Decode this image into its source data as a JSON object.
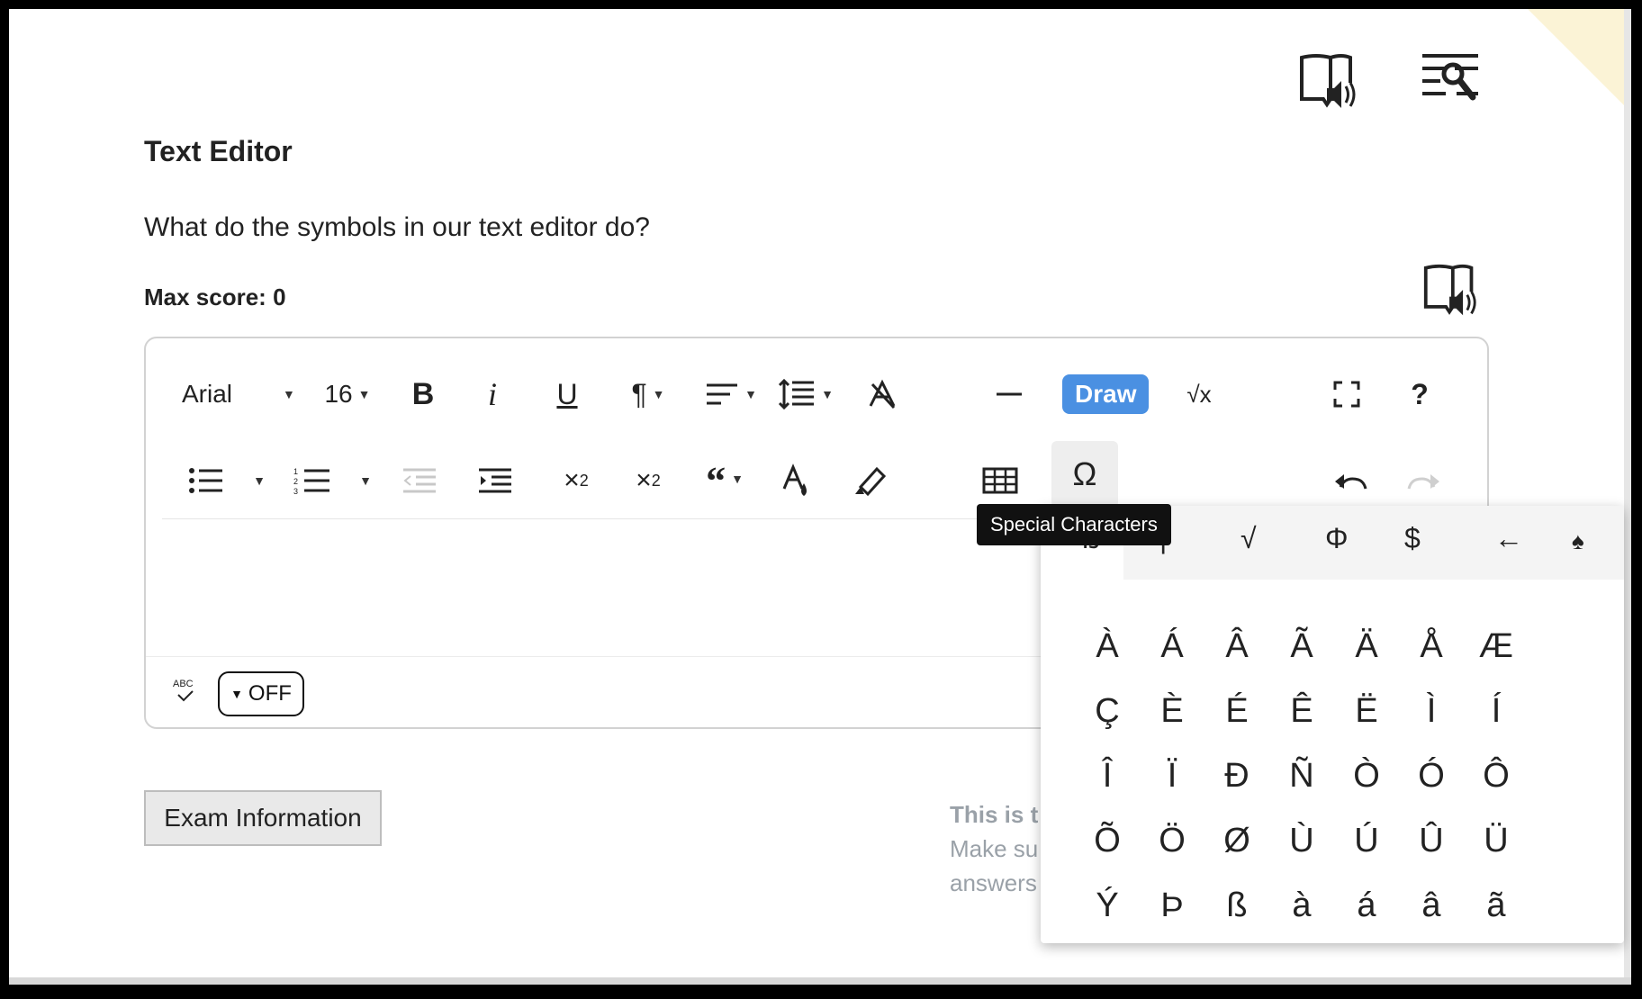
{
  "page": {
    "title": "Text Editor",
    "question": "What do the symbols in our text editor do?",
    "max_score": "Max score: 0"
  },
  "toolbar": {
    "font_family": "Arial",
    "font_size": "16",
    "draw_label": "Draw",
    "help_label": "?",
    "sqrt_label": "√x"
  },
  "tooltip": {
    "special_characters": "Special Characters"
  },
  "special_chars": {
    "tabs": [
      "ß",
      "|",
      "√",
      "Φ",
      "$",
      "←",
      "♠"
    ],
    "chars": [
      "À",
      "Á",
      "Â",
      "Ã",
      "Ä",
      "Å",
      "Æ",
      "Ç",
      "È",
      "É",
      "Ê",
      "Ë",
      "Ì",
      "Í",
      "Î",
      "Ï",
      "Ð",
      "Ñ",
      "Ò",
      "Ó",
      "Ô",
      "Õ",
      "Ö",
      "Ø",
      "Ù",
      "Ú",
      "Û",
      "Ü",
      "Ý",
      "Þ",
      "ß",
      "à",
      "á",
      "â",
      "ã"
    ]
  },
  "spellcheck": {
    "abc": "ABC",
    "toggle": "OFF"
  },
  "footer": {
    "exam_button": "Exam Information",
    "note_line1": "This is t",
    "note_line2": "Make su",
    "note_line3": "answers"
  },
  "colors": {
    "draw_button": "#4a90e2",
    "accent_corner": "#fbf3d6"
  }
}
